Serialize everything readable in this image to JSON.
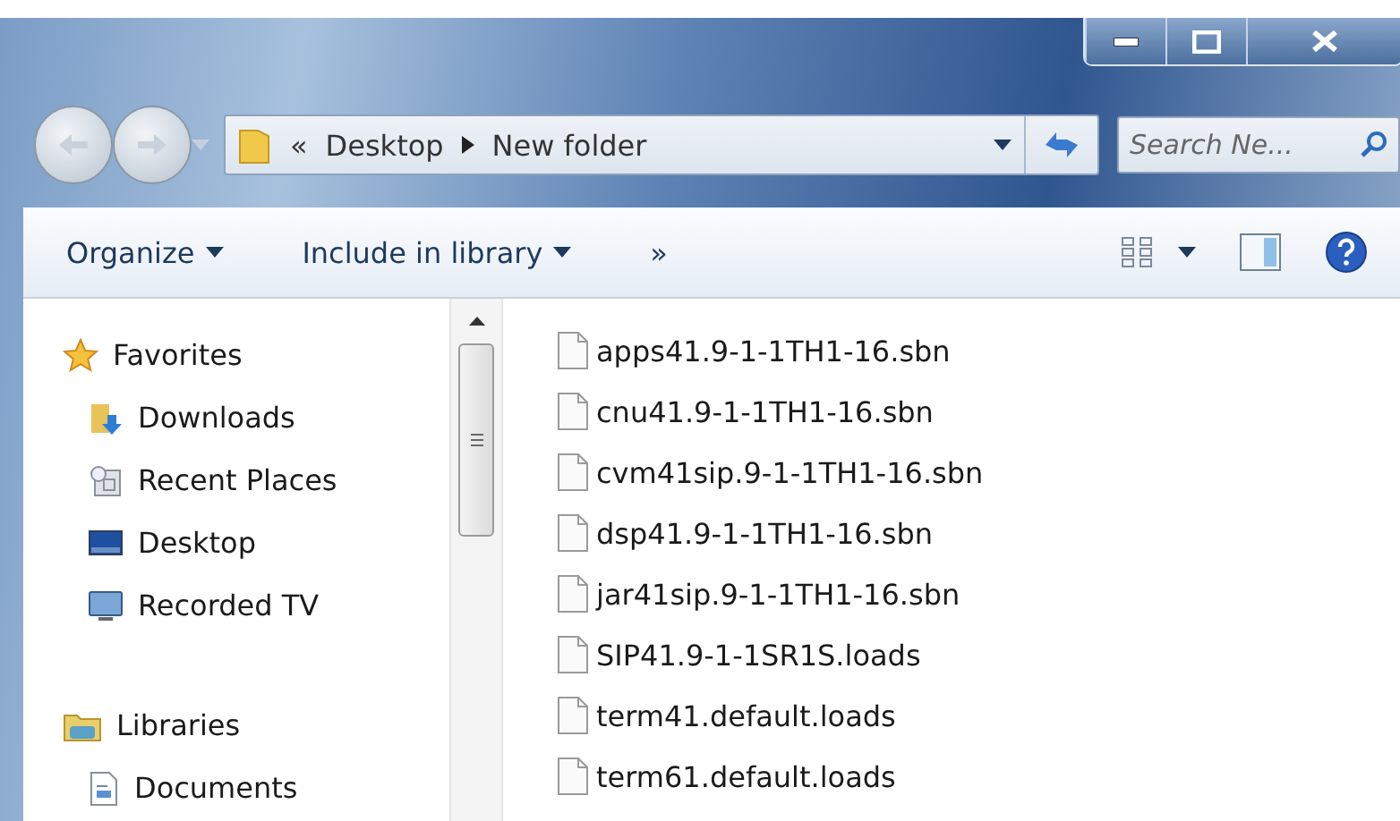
{
  "address": {
    "prefix": "«",
    "crumbs": [
      {
        "label": "Desktop"
      },
      {
        "label": "New folder"
      }
    ]
  },
  "search": {
    "placeholder": "Search Ne..."
  },
  "toolbar": {
    "items": [
      {
        "label": "Organize",
        "dropdown": true
      },
      {
        "label": "Include in library",
        "dropdown": true
      }
    ],
    "more": "»"
  },
  "navigation": {
    "groups": [
      {
        "label": "Favorites",
        "kind": "star",
        "items": [
          {
            "label": "Downloads",
            "kind": "downloads"
          },
          {
            "label": "Recent Places",
            "kind": "recent"
          },
          {
            "label": "Desktop",
            "kind": "desktop"
          },
          {
            "label": "Recorded TV",
            "kind": "tv"
          }
        ]
      },
      {
        "label": "Libraries",
        "kind": "libraries",
        "items": [
          {
            "label": "Documents",
            "kind": "documents"
          }
        ]
      }
    ]
  },
  "files": [
    {
      "name": "apps41.9-1-1TH1-16.sbn"
    },
    {
      "name": "cnu41.9-1-1TH1-16.sbn"
    },
    {
      "name": "cvm41sip.9-1-1TH1-16.sbn"
    },
    {
      "name": "dsp41.9-1-1TH1-16.sbn"
    },
    {
      "name": "jar41sip.9-1-1TH1-16.sbn"
    },
    {
      "name": "SIP41.9-1-1SR1S.loads"
    },
    {
      "name": "term41.default.loads"
    },
    {
      "name": "term61.default.loads"
    }
  ]
}
